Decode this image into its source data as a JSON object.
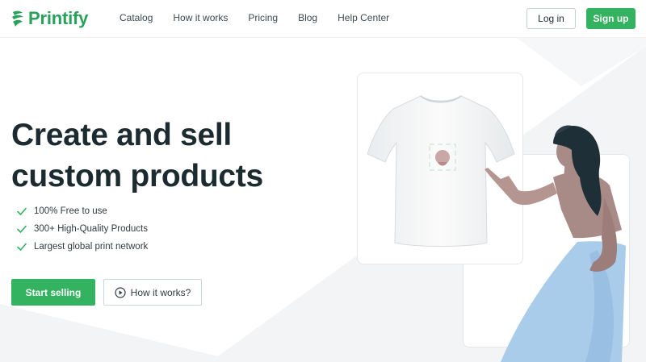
{
  "header": {
    "logo_text": "Printify",
    "nav": [
      "Catalog",
      "How it works",
      "Pricing",
      "Blog",
      "Help Center"
    ],
    "login_label": "Log in",
    "signup_label": "Sign up"
  },
  "hero": {
    "title_line1": "Create and sell",
    "title_line2": "custom products",
    "features": [
      "100% Free to use",
      "300+ High-Quality Products",
      "Largest global print network"
    ],
    "start_label": "Start selling",
    "how_label": "How it works?"
  },
  "colors": {
    "brand_green": "#33b260",
    "logo_green": "#29a15a",
    "text_dark": "#1c2b30"
  },
  "icons": [
    "printify-logo-icon",
    "check-icon",
    "play-circle-icon",
    "tshirt-icon",
    "person-illustration"
  ]
}
